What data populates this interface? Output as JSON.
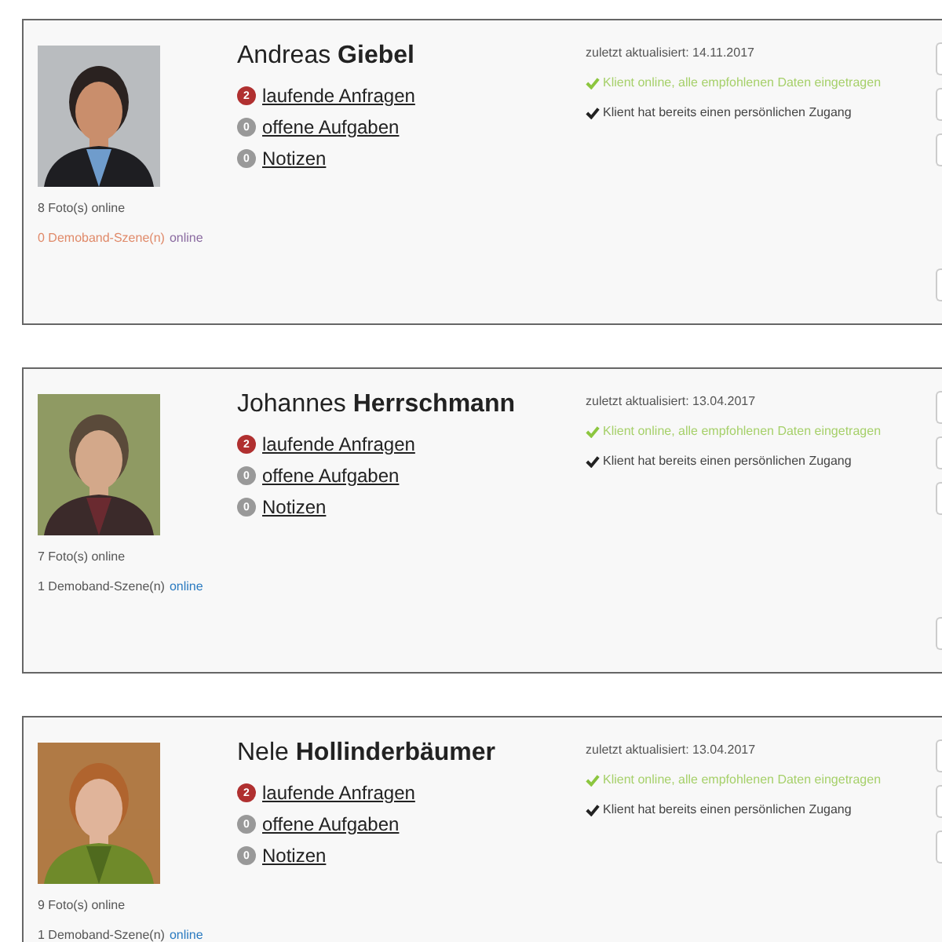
{
  "clients": [
    {
      "first_name": "Andreas",
      "last_name": "Giebel",
      "photos": "8 Foto(s) online",
      "demo": {
        "text": "0 Demoband-Szene(n)",
        "link": "online",
        "available": false
      },
      "counters": [
        {
          "count": "2",
          "label": "laufende Anfragen",
          "alert": true
        },
        {
          "count": "0",
          "label": "offene Aufgaben",
          "alert": false
        },
        {
          "count": "0",
          "label": "Notizen",
          "alert": false
        }
      ],
      "updated": "zuletzt aktualisiert: 14.11.2017",
      "statuses": [
        {
          "kind": "complete",
          "text": "Klient online, alle empfohlenen Daten eingetragen"
        },
        {
          "kind": "access",
          "text": "Klient hat bereits einen persönlichen Zugang"
        }
      ],
      "photo": {
        "kind": "picture"
      }
    },
    {
      "first_name": "Johannes",
      "last_name": "Herrschmann",
      "photos": "7 Foto(s) online",
      "demo": {
        "text": "1 Demoband-Szene(n)",
        "link": "online",
        "available": true
      },
      "counters": [
        {
          "count": "2",
          "label": "laufende Anfragen",
          "alert": true
        },
        {
          "count": "0",
          "label": "offene Aufgaben",
          "alert": false
        },
        {
          "count": "0",
          "label": "Notizen",
          "alert": false
        }
      ],
      "updated": "zuletzt aktualisiert: 13.04.2017",
      "statuses": [
        {
          "kind": "complete",
          "text": "Klient online, alle empfohlenen Daten eingetragen"
        },
        {
          "kind": "access",
          "text": "Klient hat bereits einen persönlichen Zugang"
        }
      ],
      "photo": {
        "kind": "picture"
      }
    },
    {
      "first_name": "Nele",
      "last_name": "Hollinderbäumer",
      "photos": "9 Foto(s) online",
      "demo": {
        "text": "1 Demoband-Szene(n)",
        "link": "online",
        "available": true
      },
      "counters": [
        {
          "count": "2",
          "label": "laufende Anfragen",
          "alert": true
        },
        {
          "count": "0",
          "label": "offene Aufgaben",
          "alert": false
        },
        {
          "count": "0",
          "label": "Notizen",
          "alert": false
        }
      ],
      "updated": "zuletzt aktualisiert: 13.04.2017",
      "statuses": [
        {
          "kind": "complete",
          "text": "Klient online, alle empfohlenen Daten eingetragen"
        },
        {
          "kind": "access",
          "text": "Klient hat bereits einen persönlichen Zugang"
        }
      ],
      "photo": {
        "kind": "picture"
      }
    }
  ]
}
